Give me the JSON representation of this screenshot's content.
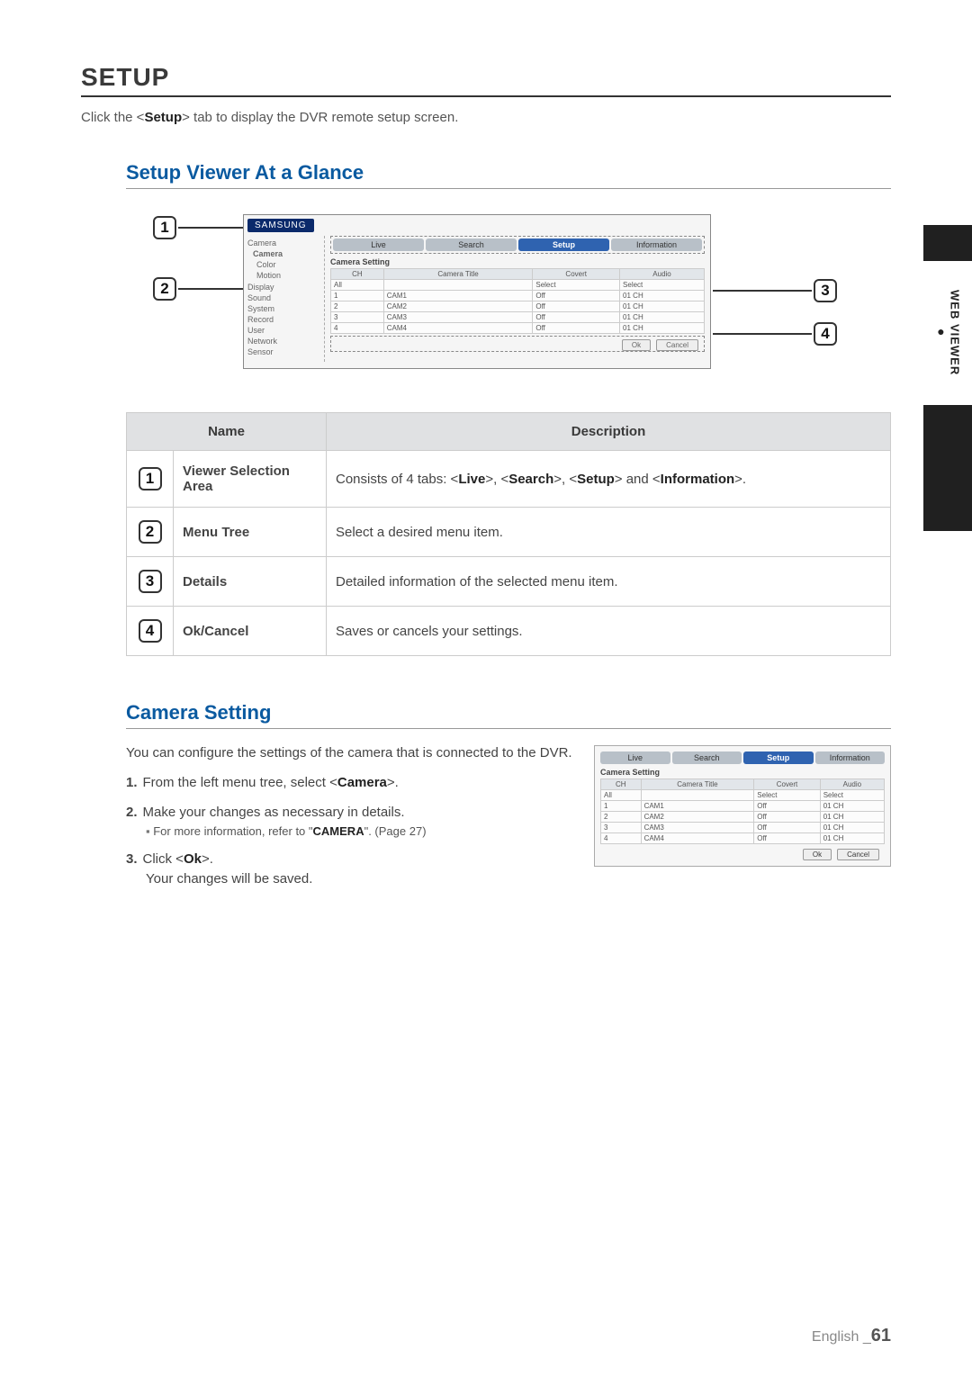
{
  "side_label": "WEB VIEWER",
  "heading": "SETUP",
  "intro_pre": "Click the <",
  "intro_bold": "Setup",
  "intro_post": "> tab to display the DVR remote setup screen.",
  "sub1": "Setup Viewer At a Glance",
  "brand": "SAMSUNG",
  "tabs": {
    "live": "Live",
    "search": "Search",
    "setup": "Setup",
    "info": "Information"
  },
  "menu": {
    "camera": "Camera",
    "camera_sel": "Camera",
    "color": "Color",
    "motion": "Motion",
    "display": "Display",
    "sound": "Sound",
    "system": "System",
    "record": "Record",
    "user": "User",
    "network": "Network",
    "sensor": "Sensor"
  },
  "panel_title": "Camera Setting",
  "cols": {
    "ch": "CH",
    "title": "Camera Title",
    "covert": "Covert",
    "audio": "Audio"
  },
  "rows": [
    {
      "ch": "All",
      "title": "",
      "covert": "Select",
      "audio": "Select"
    },
    {
      "ch": "1",
      "title": "CAM1",
      "covert": "Off",
      "audio": "01 CH"
    },
    {
      "ch": "2",
      "title": "CAM2",
      "covert": "Off",
      "audio": "01 CH"
    },
    {
      "ch": "3",
      "title": "CAM3",
      "covert": "Off",
      "audio": "01 CH"
    },
    {
      "ch": "4",
      "title": "CAM4",
      "covert": "Off",
      "audio": "01 CH"
    }
  ],
  "ok": "Ok",
  "cancel": "Cancel",
  "table": {
    "h_name": "Name",
    "h_desc": "Description",
    "r1n": "Viewer Selection Area",
    "r1d_pre": "Consists of 4 tabs: <",
    "r1d_a": "Live",
    "r1d_m1": ">, <",
    "r1d_b": "Search",
    "r1d_m2": ">, <",
    "r1d_c": "Setup",
    "r1d_m3": "> and <",
    "r1d_d": "Information",
    "r1d_post": ">.",
    "r2n": "Menu Tree",
    "r2d": "Select a desired menu item.",
    "r3n": "Details",
    "r3d": "Detailed information of the selected menu item.",
    "r4n": "Ok/Cancel",
    "r4d": "Saves or cancels your settings."
  },
  "sub2": "Camera Setting",
  "cam_intro": "You can configure the settings of the camera that is connected to the DVR.",
  "steps": {
    "s1_pre": "From the left menu tree, select <",
    "s1_b": "Camera",
    "s1_post": ">.",
    "s2": "Make your changes as necessary in details.",
    "s2_sub_pre": "For more information, refer to \"",
    "s2_sub_b": "CAMERA",
    "s2_sub_post": "\". (Page 27)",
    "s3_pre": "Click <",
    "s3_b": "Ok",
    "s3_post": ">.",
    "s3_l2": "Your changes will be saved."
  },
  "footer_lang": "English _",
  "footer_page": "61",
  "nums": {
    "n1": "1",
    "n2": "2",
    "n3": "3",
    "n4": "4"
  },
  "step_nums": {
    "n1": "1.",
    "n2": "2.",
    "n3": "3."
  }
}
